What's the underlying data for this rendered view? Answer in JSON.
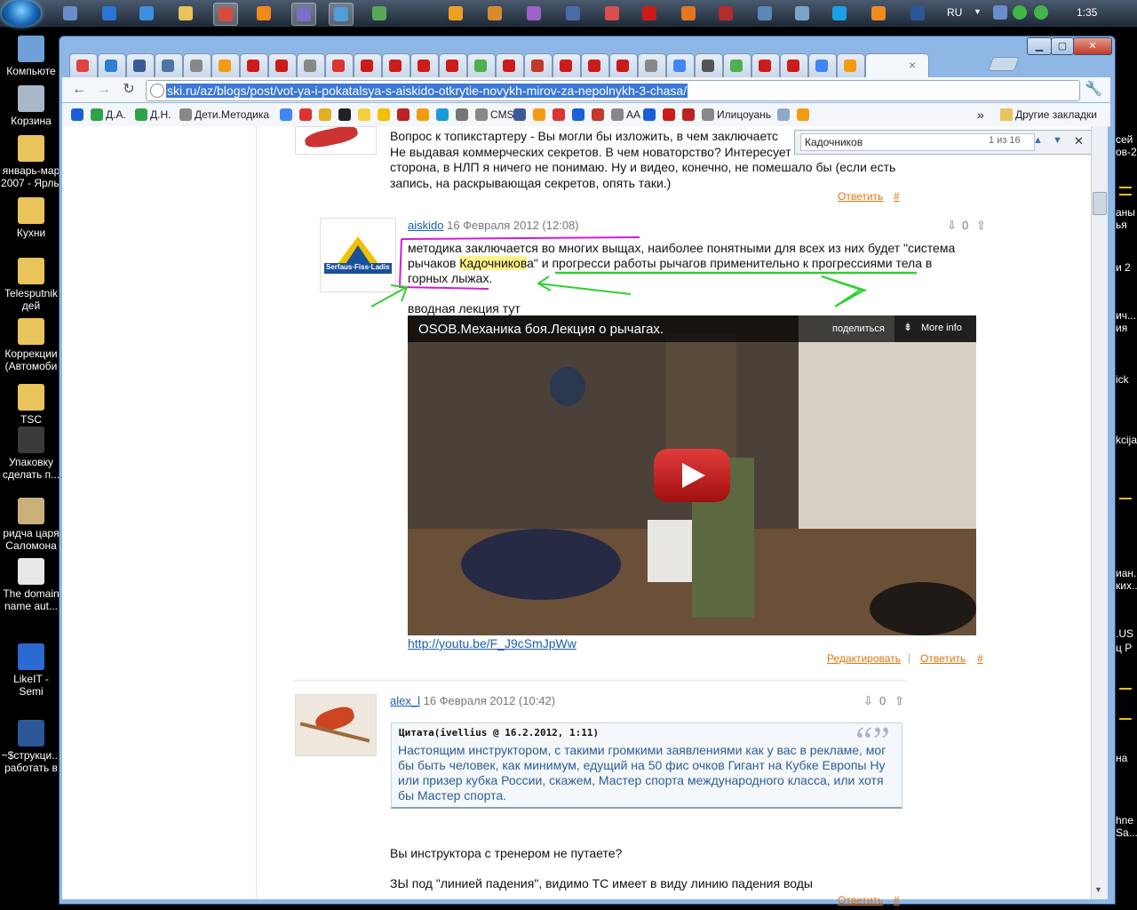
{
  "taskbar": {
    "language": "RU",
    "clock": "1:35",
    "apps": [
      {
        "name": "calculator-icon",
        "color": "#6a8cc9"
      },
      {
        "name": "teamviewer-icon",
        "color": "#2a74d5"
      },
      {
        "name": "ie-icon",
        "color": "#3b8ee0"
      },
      {
        "name": "explorer-folder-icon",
        "color": "#e9c45a"
      },
      {
        "name": "chrome-icon",
        "color": "#d64b3b"
      },
      {
        "name": "vlc-icon",
        "color": "#f08a1c"
      },
      {
        "name": "app-icon",
        "color": "#7a6ec6"
      },
      {
        "name": "window-icon",
        "color": "#4f9ed8"
      },
      {
        "name": "app-icon",
        "color": "#5aa65a"
      },
      {
        "name": "media-player-icon",
        "color": "#f0a020"
      },
      {
        "name": "app-icon",
        "color": "#d98b2c"
      },
      {
        "name": "app-icon",
        "color": "#9b63c7"
      },
      {
        "name": "save-icon",
        "color": "#4b6aa8"
      },
      {
        "name": "paint-icon",
        "color": "#d94f4f"
      },
      {
        "name": "opera-icon",
        "color": "#cc1b1b"
      },
      {
        "name": "firefox-icon",
        "color": "#e5761f"
      },
      {
        "name": "filezilla-icon",
        "color": "#b22d2d"
      },
      {
        "name": "monitor-icon",
        "color": "#5c86b8"
      },
      {
        "name": "notepad-icon",
        "color": "#7ba3c9"
      },
      {
        "name": "skype-icon",
        "color": "#1aa1e5"
      },
      {
        "name": "app-icon",
        "color": "#f08c1e"
      },
      {
        "name": "word-icon",
        "color": "#2b5797"
      }
    ]
  },
  "desktop": {
    "icons": [
      {
        "label": "Компьюте",
        "color": "#6fa0d8"
      },
      {
        "label": "Корзина",
        "color": "#a8b8c8"
      },
      {
        "label": "январь-мар 2007 - Ярлы",
        "color": "#e9c45a"
      },
      {
        "label": "Кухни",
        "color": "#e9c45a"
      },
      {
        "label": "Telesputnik дей",
        "color": "#e9c45a"
      },
      {
        "label": "Коррекции (Автомоби",
        "color": "#e9c45a"
      },
      {
        "label": "TSC",
        "color": "#e9c45a"
      },
      {
        "label": "Упаковку сделать п...",
        "color": "#3a3a3a"
      },
      {
        "label": "ридча царя Саломона",
        "color": "#c9b07a"
      },
      {
        "label": "The domain name aut...",
        "color": "#e7e7e7"
      },
      {
        "label": "LikeIT - Semi",
        "color": "#2a6ad1"
      },
      {
        "label": "~$струкци... работать в",
        "color": "#2b5797"
      }
    ],
    "right_texts": [
      "сей",
      "ов-2",
      "аны",
      "ья",
      "и 2",
      "ич...",
      "ия",
      "ick",
      "kcija",
      "иан.",
      "ких..",
      ".US",
      "ц Р",
      "на",
      "hne",
      "Sa..."
    ]
  },
  "browser": {
    "tabs": [
      {
        "name": "gmail-tab",
        "color": "#d44"
      },
      {
        "name": "it-tab",
        "color": "#2a7fd5"
      },
      {
        "name": "facebook-tab",
        "color": "#3b5998"
      },
      {
        "name": "vk-tab",
        "color": "#4c75a3"
      },
      {
        "name": "globe-tab",
        "color": "#888"
      },
      {
        "name": "app-tab",
        "color": "#f39c12"
      },
      {
        "name": "youtube-tab",
        "color": "#cc1b1b"
      },
      {
        "name": "youtube-tab",
        "color": "#cc1b1b"
      },
      {
        "name": "globe-tab",
        "color": "#888"
      },
      {
        "name": "alert-tab",
        "color": "#d33"
      },
      {
        "name": "youtube-tab",
        "color": "#cc1b1b"
      },
      {
        "name": "youtube-tab",
        "color": "#cc1b1b"
      },
      {
        "name": "youtube-tab",
        "color": "#cc1b1b"
      },
      {
        "name": "youtube-tab",
        "color": "#cc1b1b"
      },
      {
        "name": "play-tab",
        "color": "#4caf50"
      },
      {
        "name": "youtube-tab",
        "color": "#cc1b1b"
      },
      {
        "name": "refresh-tab",
        "color": "#c0392b"
      },
      {
        "name": "youtube-tab",
        "color": "#cc1b1b"
      },
      {
        "name": "youtube-tab",
        "color": "#cc1b1b"
      },
      {
        "name": "youtube-tab",
        "color": "#cc1b1b"
      },
      {
        "name": "globe-tab",
        "color": "#888"
      },
      {
        "name": "google-tab",
        "color": "#4285f4"
      },
      {
        "name": "pause-tab",
        "color": "#555"
      },
      {
        "name": "play-tab",
        "color": "#4caf50"
      },
      {
        "name": "youtube-tab",
        "color": "#cc1b1b"
      },
      {
        "name": "youtube-tab",
        "color": "#cc1b1b"
      },
      {
        "name": "google-tab",
        "color": "#4285f4"
      },
      {
        "name": "app-tab",
        "color": "#f39c12"
      }
    ],
    "close_tab": "×",
    "url": "ski.ru/az/blogs/post/vot-ya-i-pokatalsya-s-aiskido-otkrytie-novykh-mirov-za-nepolnykh-3-chasa/",
    "bookmarks": [
      {
        "label": "",
        "color": "#1a5fd8"
      },
      {
        "label": "Д.А.",
        "color": "#2ea34a"
      },
      {
        "label": "Д.Н.",
        "color": "#2ea34a"
      },
      {
        "label": "Дети.Методика",
        "color": "#888"
      },
      {
        "label": "",
        "color": "#4285f4"
      },
      {
        "label": "",
        "color": "#d33"
      },
      {
        "label": "",
        "color": "#e0b020"
      },
      {
        "label": "",
        "color": "#222"
      },
      {
        "label": "",
        "color": "#f3d23b"
      },
      {
        "label": "",
        "color": "#f3c000"
      },
      {
        "label": "",
        "color": "#b22"
      },
      {
        "label": "",
        "color": "#f39c12"
      },
      {
        "label": "",
        "color": "#1a9ad8"
      },
      {
        "label": "",
        "color": "#777"
      },
      {
        "label": "CMS",
        "color": "#888"
      },
      {
        "label": "",
        "color": "#3b5998"
      },
      {
        "label": "",
        "color": "#f39c12"
      },
      {
        "label": "",
        "color": "#d33"
      },
      {
        "label": "",
        "color": "#1a5fd8"
      },
      {
        "label": "",
        "color": "#c0392b"
      },
      {
        "label": "AA",
        "color": "#888"
      },
      {
        "label": "",
        "color": "#1a5fd8"
      },
      {
        "label": "",
        "color": "#cc1b1b"
      },
      {
        "label": "",
        "color": "#b22"
      },
      {
        "label": "Илицоуань",
        "color": "#888"
      },
      {
        "label": "",
        "color": "#8fa7c9"
      },
      {
        "label": "",
        "color": "#f39c12"
      }
    ],
    "more_bookmarks": "»",
    "other_bookmarks": "Другие закладки"
  },
  "findbar": {
    "query": "Кадочников",
    "count": "1 из 16",
    "prev": "▲",
    "next": "▼",
    "close": "✕"
  },
  "comments": {
    "first": {
      "lines": [
        "Вопрос к топикстартеру - Вы могли бы изложить, в чем заключаетс",
        "Не выдавая коммерческих секретов. В чем новаторство? Интересует",
        "сторона, в НЛП я ничего не понимаю. Ну и видео, конечно, не помешало бы (если есть",
        "запись, на раскрывающая секретов, опять таки.)"
      ],
      "reply": "Ответить",
      "hash": "#"
    },
    "second": {
      "author": "aiskido",
      "date": "16 Февраля 2012 (12:08)",
      "votes": "0",
      "avatar_text": "Serfaus·Fiss·Ladis",
      "line1": "методика заключается во многих выщах, наиболее понятными для всех из них будет \"система",
      "line2_a": "рычаков ",
      "line2_mark": "Кадочников",
      "line2_b": "а\" и прогресси работы рычагов применительно к прогрессиями тела в",
      "line3": "горных лыжах.",
      "intro": "вводная лекция тут",
      "video_title": "OSOB.Механика боя.Лекция о рычагах.",
      "video_share": "поделиться",
      "video_more": "More info",
      "link": "http://youtu.be/F_J9cSmJpWw",
      "edit": "Редактировать",
      "separator": "|",
      "reply": "Ответить",
      "hash": "#"
    },
    "third": {
      "author": "alex_l",
      "date": "16 Февраля 2012 (10:42)",
      "votes": "0",
      "quote_head": "Цитата(ivellius @ 16.2.2012, 1:11)",
      "quote_mark": "“”",
      "quote_text": "Настоящим инструктором, с такими громкими заявлениями как у вас в рекламе, мог бы быть человек, как минимум, едущий на 50 фис очков Гигант на Кубке Европы Ну или призер кубка России, скажем, Мастер спорта международного класса, или хотя бы Мастер спорта.",
      "reply_line1": "Вы инструктора с тренером не путаете?",
      "reply_line2": "ЗЫ под \"линией падения\", видимо ТС имеет в виду линию падения воды",
      "reply": "Ответить",
      "hash": "#"
    }
  }
}
